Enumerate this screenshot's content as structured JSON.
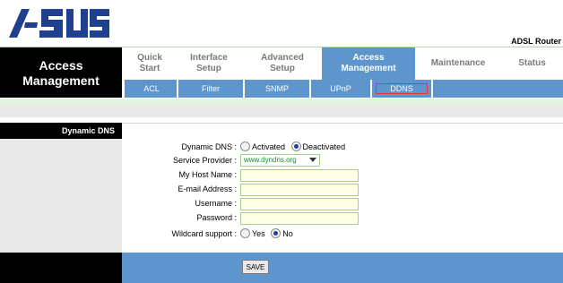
{
  "brand": {
    "logo_text": "/ISUS",
    "product": "ADSL Router"
  },
  "nav": {
    "section_title_line1": "Access",
    "section_title_line2": "Management",
    "tabs": [
      {
        "line1": "Quick",
        "line2": "Start"
      },
      {
        "line1": "Interface",
        "line2": "Setup"
      },
      {
        "line1": "Advanced",
        "line2": "Setup"
      },
      {
        "line1": "Access",
        "line2": "Management"
      },
      {
        "line1": "Maintenance",
        "line2": ""
      },
      {
        "line1": "Status",
        "line2": ""
      }
    ],
    "active_tab": "Access Management",
    "subtabs": [
      "ACL",
      "Filter",
      "SNMP",
      "UPnP",
      "DDNS"
    ],
    "active_subtab": "DDNS"
  },
  "section": {
    "title": "Dynamic DNS"
  },
  "form": {
    "dynamic_dns_label": "Dynamic DNS :",
    "activated_label": "Activated",
    "deactivated_label": "Deactivated",
    "dynamic_dns_value": "Deactivated",
    "service_provider_label": "Service Provider :",
    "service_provider_value": "www.dyndns.org",
    "host_name_label": "My Host Name :",
    "host_name_value": "",
    "email_label": "E-mail Address :",
    "email_value": "",
    "username_label": "Username :",
    "username_value": "",
    "password_label": "Password :",
    "password_value": "",
    "wildcard_label": "Wildcard support :",
    "wildcard_yes": "Yes",
    "wildcard_no": "No",
    "wildcard_value": "No",
    "save_label": "SAVE"
  },
  "colors": {
    "nav_blue": "#5f95cd",
    "field_border": "#a9cf90",
    "field_bg": "#ffffe6"
  }
}
